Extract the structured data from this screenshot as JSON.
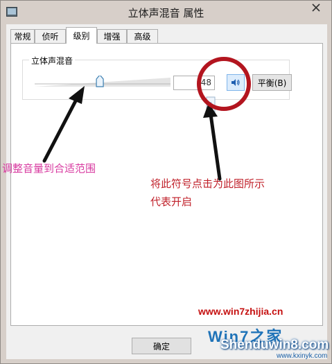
{
  "window": {
    "title": "立体声混音 属性"
  },
  "tabs": [
    {
      "label": "常规"
    },
    {
      "label": "侦听"
    },
    {
      "label": "级别"
    },
    {
      "label": "增强"
    },
    {
      "label": "高级"
    }
  ],
  "active_tab": "级别",
  "levels": {
    "group_label": "立体声混音",
    "volume_value": "48",
    "volume_fraction": 0.48,
    "balance_label": "平衡(B)"
  },
  "footer": {
    "ok_label": "确定"
  },
  "annotations": {
    "left": "调整音量到合适范围",
    "right_line1": "将此符号点击为此图所示",
    "right_line2": "代表开启"
  },
  "watermark": {
    "url": "www.win7zhijia.cn",
    "logo": "Win7之家",
    "brand": "Shenduwin8.com",
    "site": "www.kxinyk.com"
  },
  "colors": {
    "annotation_left": "#d83aa0",
    "annotation_right": "#c0202a",
    "highlight_circle": "#b3151f",
    "mute_button": "#dcecfc"
  },
  "icons": [
    "window-icon",
    "close-icon",
    "speaker-icon",
    "slider-thumb",
    "arrow-icon",
    "highlight-circle"
  ]
}
